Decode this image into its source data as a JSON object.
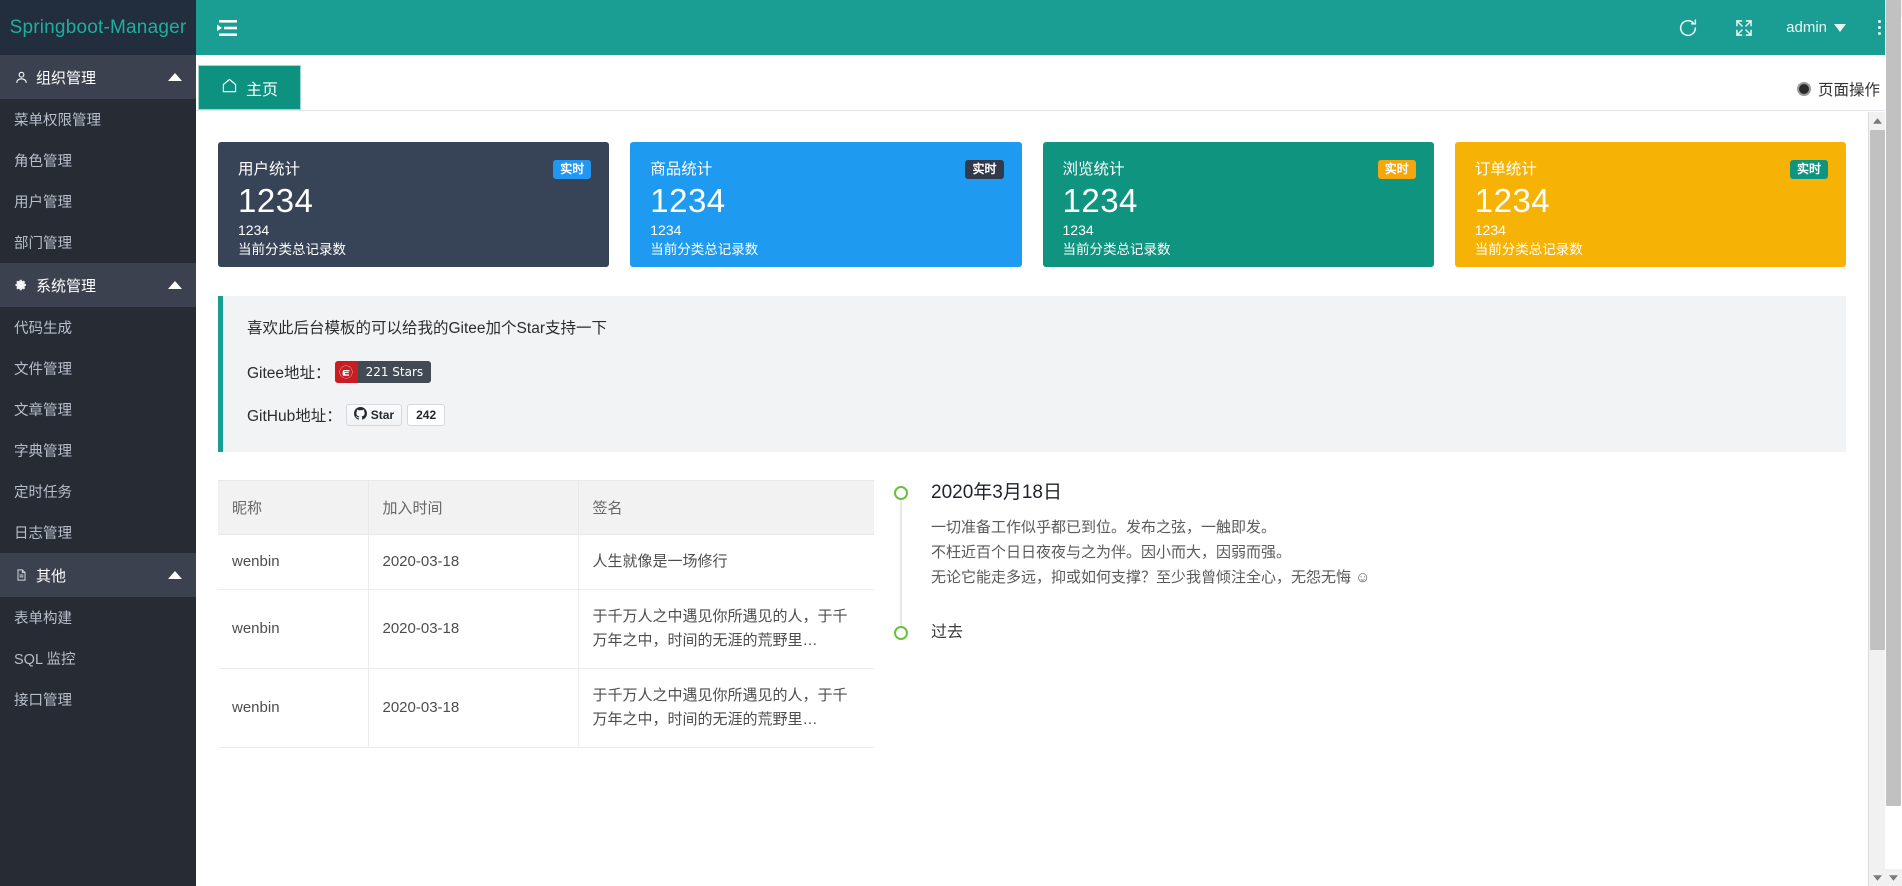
{
  "brand": {
    "title": "Springboot-Manager"
  },
  "sidebar": {
    "groups": [
      {
        "label": "组织管理",
        "icon": "user-icon",
        "items": [
          {
            "label": "菜单权限管理"
          },
          {
            "label": "角色管理"
          },
          {
            "label": "用户管理"
          },
          {
            "label": "部门管理"
          }
        ]
      },
      {
        "label": "系统管理",
        "icon": "gear-icon",
        "items": [
          {
            "label": "代码生成"
          },
          {
            "label": "文件管理"
          },
          {
            "label": "文章管理"
          },
          {
            "label": "字典管理"
          },
          {
            "label": "定时任务"
          },
          {
            "label": "日志管理"
          }
        ]
      },
      {
        "label": "其他",
        "icon": "document-icon",
        "items": [
          {
            "label": "表单构建"
          },
          {
            "label": "SQL 监控"
          },
          {
            "label": "接口管理"
          }
        ]
      }
    ]
  },
  "header": {
    "menu_fold_icon": "menu-fold-icon",
    "refresh_icon": "refresh-icon",
    "fullscreen_icon": "fullscreen-icon",
    "user_label": "admin",
    "more_icon": "more-vertical-icon"
  },
  "tabbar": {
    "home_tab": "主页",
    "home_icon": "home-icon",
    "page_ops": "页面操作"
  },
  "cards": [
    {
      "title": "用户统计",
      "badge": "实时",
      "value": "1234",
      "sub": "1234",
      "desc": "当前分类总记录数",
      "bg": "#374357",
      "badge_bg": "#2196f3",
      "badge_color": "#ffffff"
    },
    {
      "title": "商品统计",
      "badge": "实时",
      "value": "1234",
      "sub": "1234",
      "desc": "当前分类总记录数",
      "bg": "#1e9bf0",
      "badge_bg": "#32394a",
      "badge_color": "#ffffff"
    },
    {
      "title": "浏览统计",
      "badge": "实时",
      "value": "1234",
      "sub": "1234",
      "desc": "当前分类总记录数",
      "bg": "#0f9480",
      "badge_bg": "#f5a60b",
      "badge_color": "#ffffff"
    },
    {
      "title": "订单统计",
      "badge": "实时",
      "value": "1234",
      "sub": "1234",
      "desc": "当前分类总记录数",
      "bg": "#f7b206",
      "badge_bg": "#0f9480",
      "badge_color": "#ffffff"
    }
  ],
  "notice": {
    "line1": "喜欢此后台模板的可以给我的Gitee加个Star支持一下",
    "gitee_label": "Gitee地址：",
    "gitee_stars": "221 Stars",
    "gitee_icon": "gitee-icon",
    "github_label": "GitHub地址：",
    "github_star_text": "Star",
    "github_count": "242",
    "github_icon": "github-icon"
  },
  "table": {
    "columns": [
      "昵称",
      "加入时间",
      "签名"
    ],
    "rows": [
      {
        "nick": "wenbin",
        "time": "2020-03-18",
        "sign": "人生就像是一场修行"
      },
      {
        "nick": "wenbin",
        "time": "2020-03-18",
        "sign": "于千万人之中遇见你所遇见的人，于千万年之中，时间的无涯的荒野里…"
      },
      {
        "nick": "wenbin",
        "time": "2020-03-18",
        "sign": "于千万人之中遇见你所遇见的人，于千万年之中，时间的无涯的荒野里…"
      }
    ]
  },
  "timeline": [
    {
      "title": "2020年3月18日",
      "lines": [
        "一切准备工作似乎都已到位。发布之弦，一触即发。",
        "不枉近百个日日夜夜与之为伴。因小而大，因弱而强。",
        "无论它能走多远，抑或如何支撑？至少我曾倾注全心，无怨无悔 ☺"
      ]
    },
    {
      "title": "过去",
      "lines": []
    }
  ],
  "colors": {
    "teal": "#1a9e93",
    "tab_teal": "#0e9280",
    "sidebar_bg": "#272b33",
    "sidebar_group_bg": "#3b414e",
    "brand_bg": "#222e3e"
  }
}
